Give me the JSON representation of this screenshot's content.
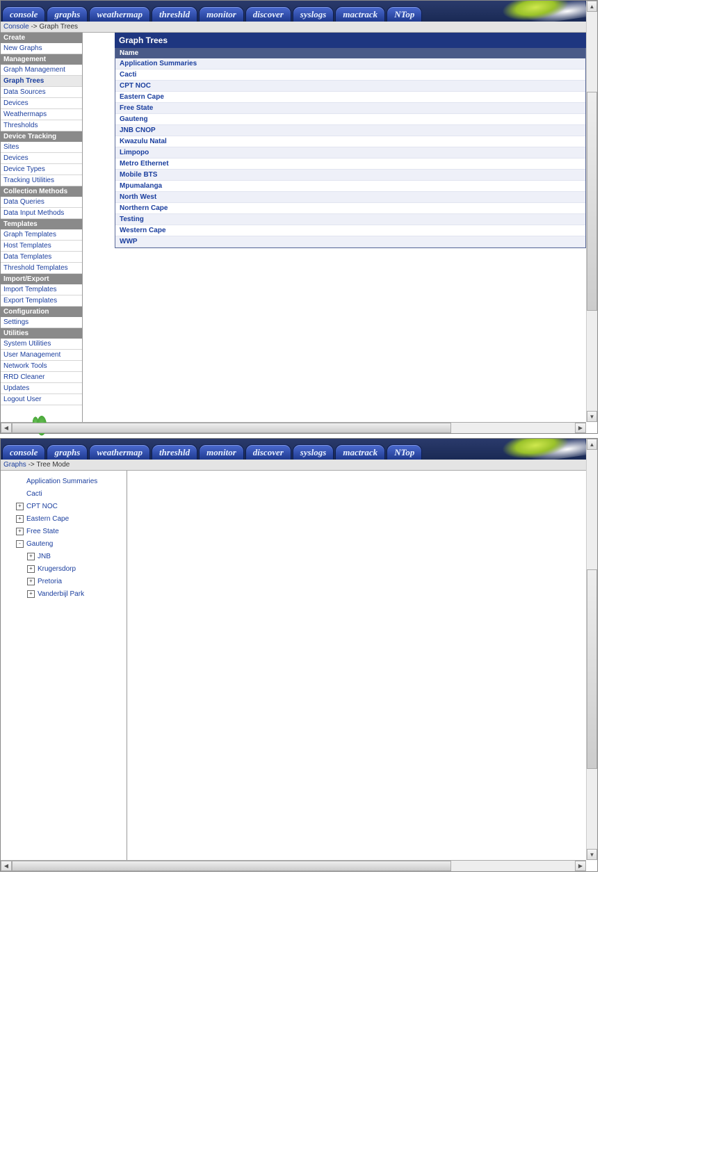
{
  "tabs": [
    "console",
    "graphs",
    "weathermap",
    "threshld",
    "monitor",
    "discover",
    "syslogs",
    "mactrack",
    "NTop"
  ],
  "screenshot1": {
    "breadcrumb": {
      "link": "Console",
      "sep": " -> ",
      "page": "Graph Trees"
    },
    "nav": [
      {
        "type": "header",
        "label": "Create"
      },
      {
        "type": "item",
        "label": "New Graphs"
      },
      {
        "type": "header",
        "label": "Management"
      },
      {
        "type": "item",
        "label": "Graph Management"
      },
      {
        "type": "item",
        "label": "Graph Trees",
        "active": true
      },
      {
        "type": "item",
        "label": "Data Sources"
      },
      {
        "type": "item",
        "label": "Devices"
      },
      {
        "type": "item",
        "label": "Weathermaps"
      },
      {
        "type": "item",
        "label": "Thresholds"
      },
      {
        "type": "header",
        "label": "Device Tracking"
      },
      {
        "type": "item",
        "label": "Sites"
      },
      {
        "type": "item",
        "label": "Devices"
      },
      {
        "type": "item",
        "label": "Device Types"
      },
      {
        "type": "item",
        "label": "Tracking Utilities"
      },
      {
        "type": "header",
        "label": "Collection Methods"
      },
      {
        "type": "item",
        "label": "Data Queries"
      },
      {
        "type": "item",
        "label": "Data Input Methods"
      },
      {
        "type": "header",
        "label": "Templates"
      },
      {
        "type": "item",
        "label": "Graph Templates"
      },
      {
        "type": "item",
        "label": "Host Templates"
      },
      {
        "type": "item",
        "label": "Data Templates"
      },
      {
        "type": "item",
        "label": "Threshold Templates"
      },
      {
        "type": "header",
        "label": "Import/Export"
      },
      {
        "type": "item",
        "label": "Import Templates"
      },
      {
        "type": "item",
        "label": "Export Templates"
      },
      {
        "type": "header",
        "label": "Configuration"
      },
      {
        "type": "item",
        "label": "Settings"
      },
      {
        "type": "header",
        "label": "Utilities"
      },
      {
        "type": "item",
        "label": "System Utilities"
      },
      {
        "type": "item",
        "label": "User Management"
      },
      {
        "type": "item",
        "label": "Network Tools"
      },
      {
        "type": "item",
        "label": "RRD Cleaner"
      },
      {
        "type": "item",
        "label": "Updates"
      },
      {
        "type": "item",
        "label": "Logout User"
      }
    ],
    "panel": {
      "title": "Graph Trees",
      "column": "Name",
      "rows": [
        "Application Summaries",
        "Cacti",
        "CPT NOC",
        "Eastern Cape",
        "Free State",
        "Gauteng",
        "JNB CNOP",
        "Kwazulu Natal",
        "Limpopo",
        "Metro Ethernet",
        "Mobile BTS",
        "Mpumalanga",
        "North West",
        "Northern Cape",
        "Testing",
        "Western Cape",
        "WWP"
      ]
    }
  },
  "screenshot2": {
    "breadcrumb": {
      "link": "Graphs",
      "sep": " -> ",
      "page": "Tree Mode"
    },
    "tree": [
      {
        "label": "Application Summaries",
        "depth": 1,
        "toggle": null
      },
      {
        "label": "Cacti",
        "depth": 1,
        "toggle": null
      },
      {
        "label": "CPT NOC",
        "depth": 1,
        "toggle": "+"
      },
      {
        "label": "Eastern Cape",
        "depth": 1,
        "toggle": "+"
      },
      {
        "label": "Free State",
        "depth": 1,
        "toggle": "+"
      },
      {
        "label": "Gauteng",
        "depth": 1,
        "toggle": "-"
      },
      {
        "label": "JNB",
        "depth": 2,
        "toggle": "+"
      },
      {
        "label": "Krugersdorp",
        "depth": 2,
        "toggle": "+"
      },
      {
        "label": "Pretoria",
        "depth": 2,
        "toggle": "+"
      },
      {
        "label": "Vanderbijl Park",
        "depth": 2,
        "toggle": "+"
      }
    ]
  }
}
